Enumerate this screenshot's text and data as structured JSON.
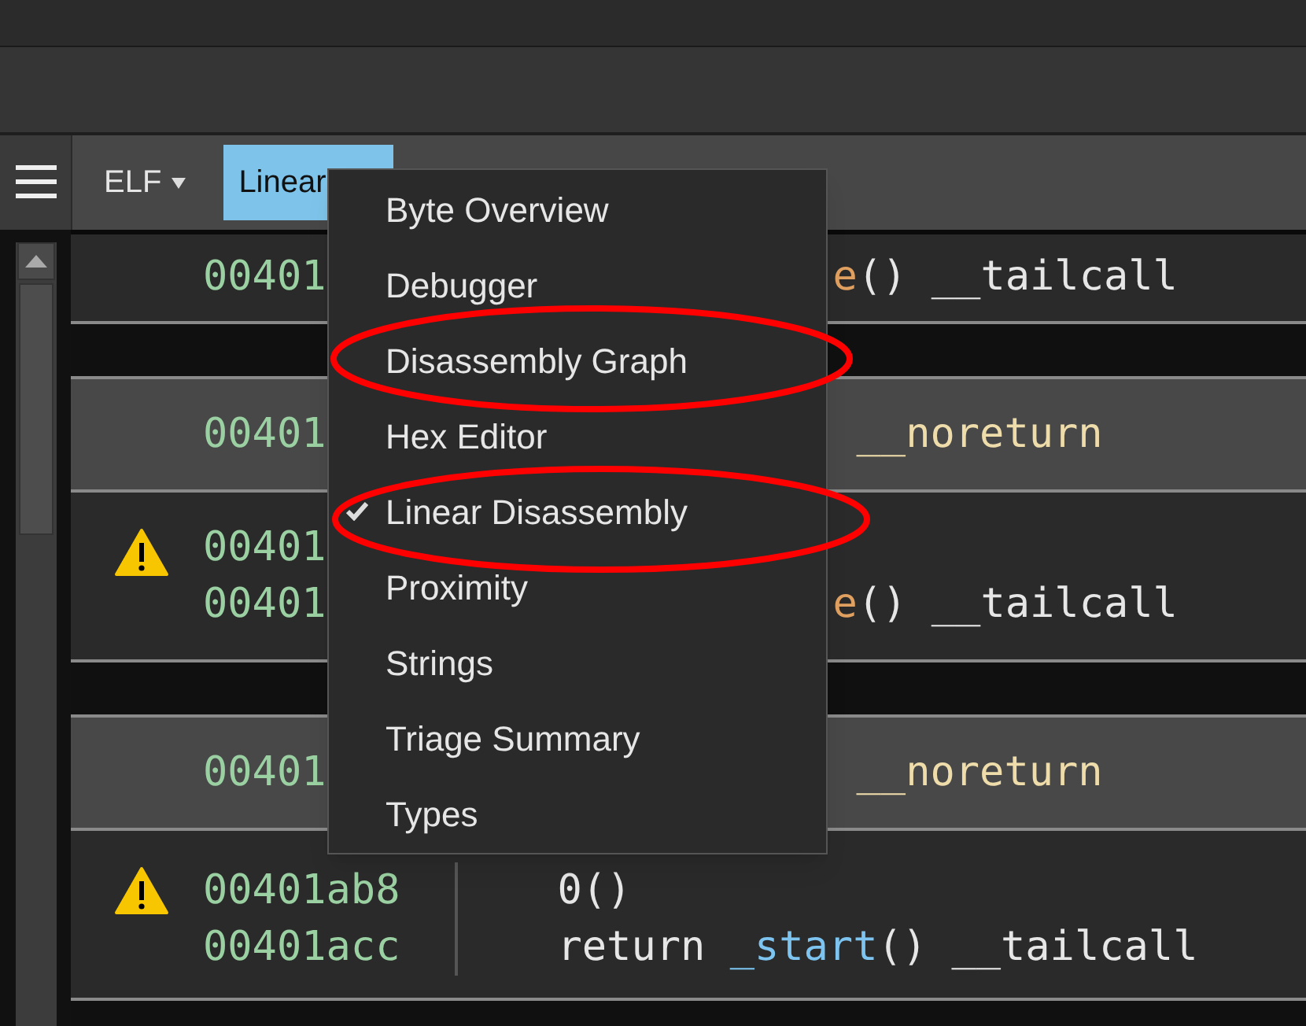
{
  "tabs": [
    {
      "label": "ELF",
      "kind": "dropdown",
      "selected": false
    },
    {
      "label": "Linear",
      "kind": "plain",
      "selected": true
    }
  ],
  "blocks": [
    {
      "kind": "clipped",
      "warning": false,
      "lines": [
        {
          "address": "00401",
          "tokens": [
            {
              "text": "e",
              "kind": "symbol"
            },
            {
              "text": "() __tailcall",
              "kind": "plain"
            }
          ]
        }
      ]
    },
    {
      "kind": "header",
      "warning": false,
      "lines": [
        {
          "address": "00401",
          "tokens": [
            {
              "text": "__noreturn",
              "kind": "keyword"
            }
          ]
        }
      ]
    },
    {
      "kind": "clipped",
      "warning": true,
      "lines": [
        {
          "address": "00401"
        },
        {
          "address": "00401",
          "tokens": [
            {
              "text": "e",
              "kind": "symbol"
            },
            {
              "text": "() __tailcall",
              "kind": "plain"
            }
          ]
        }
      ]
    },
    {
      "kind": "header",
      "warning": false,
      "lines": [
        {
          "address": "00401",
          "tokens": [
            {
              "text": "__noreturn",
              "kind": "keyword"
            }
          ]
        }
      ]
    },
    {
      "kind": "code",
      "warning": true,
      "lines": [
        {
          "address": "00401ab8",
          "tokens": [
            {
              "text": "0()",
              "kind": "plain"
            }
          ]
        },
        {
          "address": "00401acc",
          "tokens": [
            {
              "text": "return ",
              "kind": "plain"
            },
            {
              "text": "_start",
              "kind": "function"
            },
            {
              "text": "() __tailcall",
              "kind": "plain"
            }
          ]
        }
      ]
    }
  ],
  "menu": {
    "items": [
      {
        "label": "Byte Overview",
        "checked": false
      },
      {
        "label": "Debugger",
        "checked": false
      },
      {
        "label": "Disassembly Graph",
        "checked": false
      },
      {
        "label": "Hex Editor",
        "checked": false
      },
      {
        "label": "Linear Disassembly",
        "checked": true
      },
      {
        "label": "Proximity",
        "checked": false
      },
      {
        "label": "Strings",
        "checked": false
      },
      {
        "label": "Triage Summary",
        "checked": false
      },
      {
        "label": "Types",
        "checked": false
      }
    ]
  },
  "highlights": [
    {
      "color": "#ff0000"
    },
    {
      "color": "#ff0000"
    }
  ]
}
